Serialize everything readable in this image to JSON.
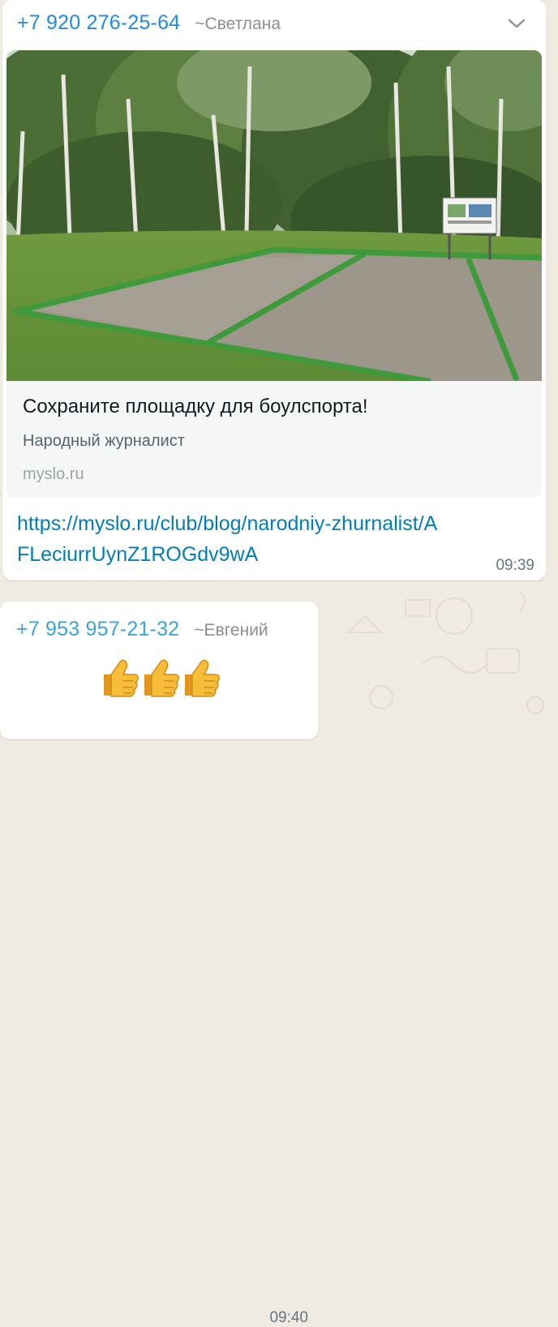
{
  "theme": {
    "link_color": "#027eb5",
    "sender1_color": "#1f8be0",
    "sender2_color": "#3aa3d8",
    "chat_background": "#efeae2"
  },
  "messages": [
    {
      "phone": "+7 920 276-25-64",
      "push_name": "~Светлана",
      "menu_icon": "chevron-down-icon",
      "preview": {
        "title": "Сохраните площадку для боулспорта!",
        "description": "Народный журналист",
        "domain": "myslo.ru"
      },
      "link": "https://myslo.ru/club/blog/narodniy-zhurnalist/AFLeciurrUynZ1ROGdv9wA",
      "time": "09:39"
    },
    {
      "phone": "+7 953 957-21-32",
      "push_name": "~Евгений",
      "emoji": [
        "thumbs-up-icon",
        "thumbs-up-icon",
        "thumbs-up-icon"
      ],
      "time": "09:40"
    }
  ]
}
